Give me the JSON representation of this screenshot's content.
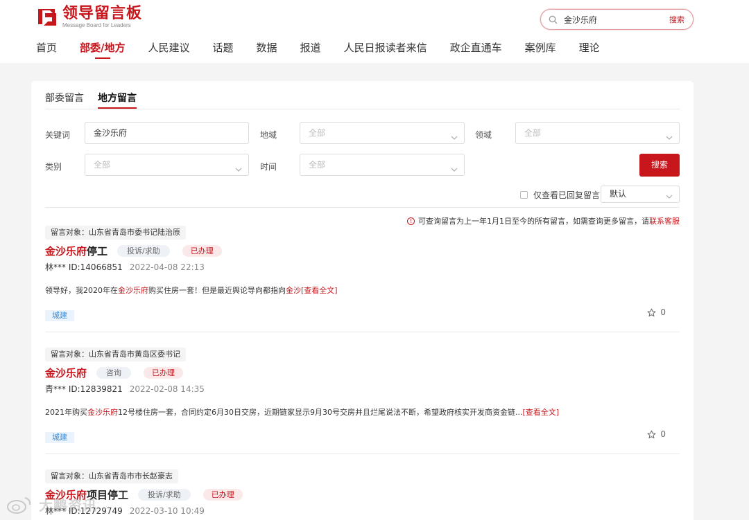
{
  "brand": {
    "title": "领导留言板",
    "subtitle": "Message Board for Leaders"
  },
  "top_search": {
    "value": "金沙乐府",
    "button": "搜索"
  },
  "nav": [
    "首页",
    "部委/地方",
    "人民建议",
    "话题",
    "数据",
    "报道",
    "人民日报读者来信",
    "政企直通车",
    "案例库",
    "理论"
  ],
  "nav_active": "部委/地方",
  "sub_tabs": [
    "部委留言",
    "地方留言"
  ],
  "sub_tab_active": "地方留言",
  "filters": {
    "keyword_label": "关键词",
    "keyword_value": "金沙乐府",
    "region_label": "地域",
    "region_value": "全部",
    "domain_label": "领域",
    "domain_value": "全部",
    "category_label": "类别",
    "category_value": "全部",
    "time_label": "时间",
    "time_value": "全部",
    "search_button": "搜索",
    "only_replied": "仅查看已回复留言",
    "sort_value": "默认"
  },
  "notice": {
    "text": "可查询留言为上一年1月1日至今的所有留言，如需查询更多留言，请",
    "link": "联系客服"
  },
  "messages": [
    {
      "target": "留言对象：山东省青岛市委书记陆治原",
      "title_hl": "金沙乐府",
      "title_rest": "停工",
      "type": "投诉/求助",
      "status": "已办理",
      "author": "林***",
      "id": "ID:14066851",
      "date": "2022-04-08 22:13",
      "body_pre": "领导好，我2020年在",
      "body_hl": "金沙乐府",
      "body_mid": "购买住房一套！但是最近舆论导向都指向",
      "body_hl2": "金沙",
      "more": "[查看全文]",
      "field": "城建",
      "stars": "0"
    },
    {
      "target": "留言对象：山东省青岛市黄岛区委书记",
      "title_hl": "金沙乐府",
      "title_rest": "",
      "type": "咨询",
      "status": "已办理",
      "author": "青***",
      "id": "ID:12839821",
      "date": "2022-02-08 14:35",
      "body_pre": "2021年购买",
      "body_hl": "金沙乐府",
      "body_mid": "12号楼住房一套，合同约定6月30日交房，近期链家显示9月30号交房并且烂尾说法不断，希望政府核实开发商资金链...",
      "body_hl2": "",
      "more": "[查看全文]",
      "field": "城建",
      "stars": "0"
    },
    {
      "target": "留言对象：山东省青岛市市长赵豪志",
      "title_hl": "金沙乐府",
      "title_rest": "项目停工",
      "type": "投诉/求助",
      "status": "已办理",
      "author": "林***",
      "id": "ID:12729749",
      "date": "2022-03-10 10:49"
    }
  ],
  "watermark": "大鹏资讯"
}
